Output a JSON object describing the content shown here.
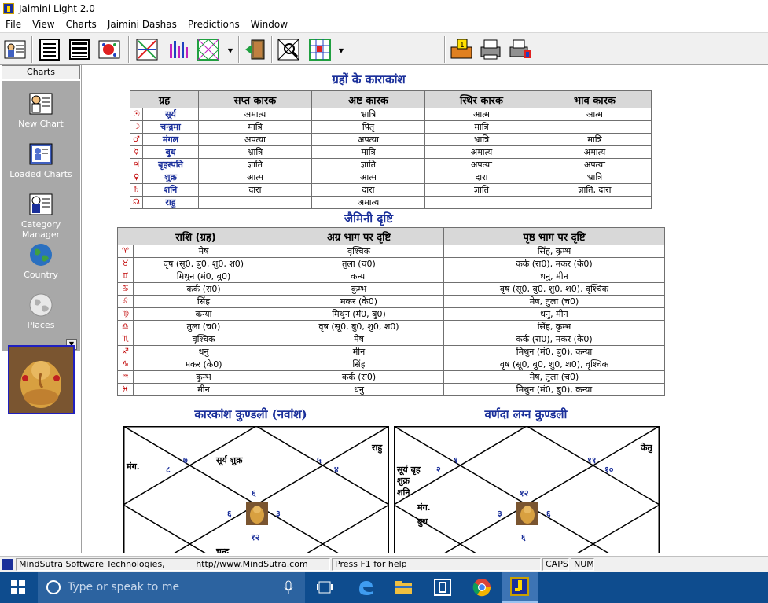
{
  "window": {
    "title": "Jaimini Light 2.0"
  },
  "menu": [
    "File",
    "View",
    "Charts",
    "Jaimini Dashas",
    "Predictions",
    "Window"
  ],
  "sidebar": {
    "header": "Charts",
    "items": [
      {
        "label": "New Chart",
        "icon": "new-chart-icon"
      },
      {
        "label": "Loaded Charts",
        "icon": "loaded-charts-icon"
      },
      {
        "label": "Category Manager",
        "icon": "category-manager-icon"
      },
      {
        "label": "Country",
        "icon": "globe-icon"
      },
      {
        "label": "Places",
        "icon": "places-globe-icon"
      }
    ]
  },
  "karakamsha": {
    "title": "ग्रहों के काराकांश",
    "headers": [
      "ग्रह",
      "सप्त कारक",
      "अष्ट कारक",
      "स्थिर कारक",
      "भाव कारक"
    ],
    "rows": [
      {
        "sym": "☉",
        "planet": "सूर्य",
        "c1": "अमात्य",
        "c2": "भ्रात्रि",
        "c3": "आत्म",
        "c4": "आत्म"
      },
      {
        "sym": "☽",
        "planet": "चन्द्रमा",
        "c1": "मात्रि",
        "c2": "पितृ",
        "c3": "मात्रि",
        "c4": ""
      },
      {
        "sym": "♂",
        "planet": "मंगल",
        "c1": "अपत्या",
        "c2": "अपत्या",
        "c3": "भ्रात्रि",
        "c4": "मात्रि"
      },
      {
        "sym": "☿",
        "planet": "बुध",
        "c1": "भ्रात्रि",
        "c2": "मात्रि",
        "c3": "अमात्य",
        "c4": "अमात्य"
      },
      {
        "sym": "♃",
        "planet": "बृहस्पति",
        "c1": "ज्ञाति",
        "c2": "ज्ञाति",
        "c3": "अपत्या",
        "c4": "अपत्या"
      },
      {
        "sym": "♀",
        "planet": "शुक्र",
        "c1": "आत्म",
        "c2": "आत्म",
        "c3": "दारा",
        "c4": "भ्रात्रि"
      },
      {
        "sym": "♄",
        "planet": "शनि",
        "c1": "दारा",
        "c2": "दारा",
        "c3": "ज्ञाति",
        "c4": "ज्ञाति, दारा"
      },
      {
        "sym": "☊",
        "planet": "राहु",
        "c1": "",
        "c2": "अमात्य",
        "c3": "",
        "c4": ""
      }
    ]
  },
  "drishti": {
    "title": "जैमिनी दृष्टि",
    "headers": [
      "राशि (ग्रह)",
      "अग्र भाग पर दृष्टि",
      "पृष्ठ भाग पर दृष्टि"
    ],
    "rows": [
      {
        "sym": "♈",
        "rashi": "मेष",
        "agra": "वृश्चिक",
        "prishta": "सिंह, कुम्भ"
      },
      {
        "sym": "♉",
        "rashi": "वृष (सू0, बु0, शु0, श0)",
        "agra": "तुला (च0)",
        "prishta": "कर्क (रा0), मकर (के0)"
      },
      {
        "sym": "♊",
        "rashi": "मिथुन (मं0, बु0)",
        "agra": "कन्या",
        "prishta": "धनु, मीन"
      },
      {
        "sym": "♋",
        "rashi": "कर्क (रा0)",
        "agra": "कुम्भ",
        "prishta": "वृष (सू0, बु0, शु0, श0), वृश्चिक"
      },
      {
        "sym": "♌",
        "rashi": "सिंह",
        "agra": "मकर (के0)",
        "prishta": "मेष, तुला (च0)"
      },
      {
        "sym": "♍",
        "rashi": "कन्या",
        "agra": "मिथुन (मं0, बु0)",
        "prishta": "धनु, मीन"
      },
      {
        "sym": "♎",
        "rashi": "तुला (च0)",
        "agra": "वृष (सू0, बु0, शु0, श0)",
        "prishta": "सिंह, कुम्भ"
      },
      {
        "sym": "♏",
        "rashi": "वृश्चिक",
        "agra": "मेष",
        "prishta": "कर्क (रा0), मकर (के0)"
      },
      {
        "sym": "♐",
        "rashi": "धनु",
        "agra": "मीन",
        "prishta": "मिथुन (मं0, बु0), कन्या"
      },
      {
        "sym": "♑",
        "rashi": "मकर (के0)",
        "agra": "सिंह",
        "prishta": "वृष (सू0, बु0, शु0, श0), वृश्चिक"
      },
      {
        "sym": "♒",
        "rashi": "कुम्भ",
        "agra": "कर्क (रा0)",
        "prishta": "मेष, तुला (च0)"
      },
      {
        "sym": "♓",
        "rashi": "मीन",
        "agra": "धनु",
        "prishta": "मिथुन (मं0, बु0), कन्या"
      }
    ]
  },
  "chart1": {
    "title": "कारकांश कुण्डली (नवांश)",
    "labels": {
      "mangal": "मंग.",
      "surya_shukra": "सूर्य शुक्र",
      "rahu": "राहु",
      "bottom": "चन्द्र"
    },
    "nums": {
      "n7": "७",
      "n8": "८",
      "n5": "५",
      "n4": "४",
      "n6": "६",
      "n9": "६",
      "n3": "३",
      "n12": "१२"
    }
  },
  "chart2": {
    "title": "वर्णदा लग्न कुण्डली",
    "labels": {
      "ketu": "केतु",
      "surya_brih": "सूर्य बृह",
      "shukra": "शुक्र",
      "shani": "शनि",
      "mangal": "मंग.",
      "budh": "बुध"
    },
    "nums": {
      "n1": "१",
      "n2": "२",
      "n11": "११",
      "n10": "१०",
      "n12": "१२",
      "n3": "३",
      "n6": "६",
      "n6b": "६"
    }
  },
  "status": {
    "company": "MindSutra Software Technologies,",
    "url": "http//www.MindSutra.com",
    "help": "Press F1 for help",
    "caps": "CAPS",
    "num": "NUM"
  },
  "taskbar": {
    "search_placeholder": "Type or speak to me"
  }
}
